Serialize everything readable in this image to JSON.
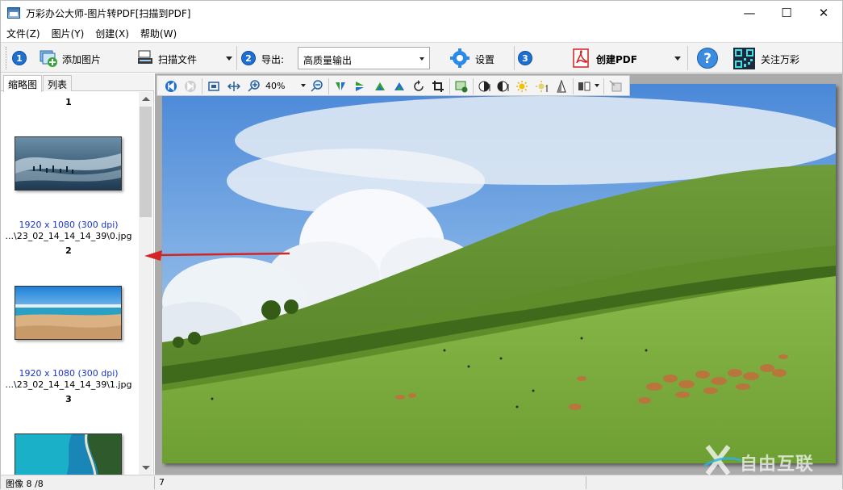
{
  "window": {
    "title": "万彩办公大师-图片转PDF[扫描到PDF]",
    "controls": [
      "—",
      "☐",
      "✕"
    ]
  },
  "menu": [
    "文件(Z)",
    "图片(Y)",
    "创建(X)",
    "帮助(W)"
  ],
  "toolbar": {
    "step1": "1",
    "add_images": "添加图片",
    "scan_file": "扫描文件",
    "step2": "2",
    "export_label": "导出:",
    "export_value": "高质量输出",
    "settings": "设置",
    "step3": "3",
    "create_pdf": "创建PDF",
    "follow": "关注万彩"
  },
  "left_panel": {
    "tabs": [
      "缩略图",
      "列表"
    ],
    "thumbnails": [
      {
        "num": "1",
        "res": "1920 x 1080 (300 dpi)",
        "path": "...\\23_02_14_14_14_39\\0.jpg"
      },
      {
        "num": "2",
        "res": "1920 x 1080 (300 dpi)",
        "path": "...\\23_02_14_14_14_39\\1.jpg"
      },
      {
        "num": "3"
      }
    ]
  },
  "viewer": {
    "zoom": "40%"
  },
  "status": {
    "images": "图像 8 /8",
    "page": "7"
  },
  "colors": {
    "accent": "#1f6fd1",
    "thumb_res": "#1a36c8",
    "pdf_red": "#d32020",
    "annotation_arrow": "#d42525"
  },
  "watermark": "自由互联"
}
